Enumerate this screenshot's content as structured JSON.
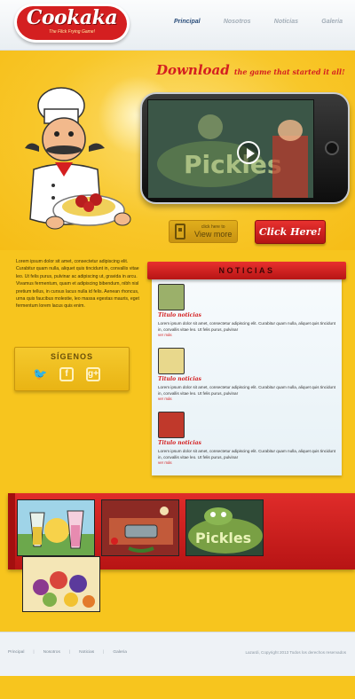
{
  "brand": {
    "logo_text": "Cookaka",
    "tagline": "The Flick Frying Game!"
  },
  "nav": {
    "items": [
      {
        "label": "Principal",
        "active": true
      },
      {
        "label": "Nosotros",
        "active": false
      },
      {
        "label": "Noticias",
        "active": false
      },
      {
        "label": "Galeria",
        "active": false
      }
    ]
  },
  "hero": {
    "headline_big": "Download",
    "headline_rest": "the game that started it all!",
    "video_title": "Pickles"
  },
  "cta": {
    "view_more_small": "click here to",
    "view_more_label": "View more",
    "click_here_label": "Click Here!"
  },
  "intro": {
    "text": "Lorem ipsum dolor sit amet, consectetur adipiscing elit. Curabitur quam nulla, aliquet quis tincidunt in, convallis vitae leo. Ut felis purus, pulvinar ac adipiscing ut, gravida in arcu. Vivamus fermentum, quam et adipiscing bibendum, nibh nisl pretium tellus, in cursus lacus nulla id felis. Aenean rhoncus, urna quis faucibus molestie, leo massa egestas mauris, eget fermentum lorem lacus quis enim."
  },
  "social": {
    "title": "SÍGENOS",
    "items": [
      "twitter",
      "facebook",
      "google-plus"
    ]
  },
  "news": {
    "title": "NOTICIAS",
    "items": [
      {
        "title": "Titulo noticias",
        "text": "Lorem ipsum dolor sit amet, consectetur adipiscing elit. Curabitur quam nulla, aliquet quis tincidunt in, convallis vitae leo. Ut felis purus, pulvinar",
        "link": "ver más",
        "thumb_color": "#9bb06a"
      },
      {
        "title": "Titulo noticias",
        "text": "Lorem ipsum dolor sit amet, consectetur adipiscing elit. Curabitur quam nulla, aliquet quis tincidunt in, convallis vitae leo. Ut felis purus, pulvinar",
        "link": "ver más",
        "thumb_color": "#e8d88c"
      },
      {
        "title": "Titulo noticias",
        "text": "Lorem ipsum dolor sit amet, consectetur adipiscing elit. Curabitur quam nulla, aliquet quis tincidunt in, convallis vitae leo. Ut felis purus, pulvinar",
        "link": "ver más",
        "thumb_color": "#c0392b"
      }
    ]
  },
  "gallery": {
    "thumb_label": "Pickles"
  },
  "footer": {
    "links": [
      "Principal",
      "Nosotros",
      "Noticias",
      "Galeria"
    ],
    "copyright": "Lazardi, Copyright 2013 Todos los derechos reservados"
  },
  "colors": {
    "brand_red": "#d41f20",
    "page_yellow": "#f7c51e",
    "nav_active": "#2a4d7a"
  }
}
